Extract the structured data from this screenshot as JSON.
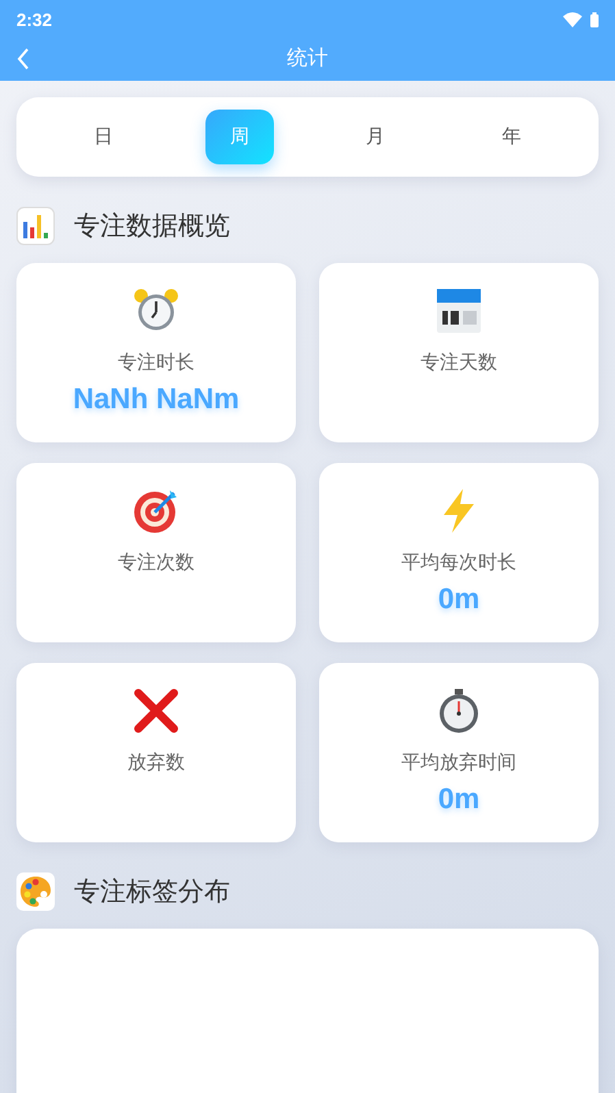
{
  "status_bar": {
    "time": "2:32"
  },
  "header": {
    "title": "统计"
  },
  "period_tabs": [
    {
      "label": "日",
      "selected": false
    },
    {
      "label": "周",
      "selected": true
    },
    {
      "label": "月",
      "selected": false
    },
    {
      "label": "年",
      "selected": false
    }
  ],
  "overview": {
    "title": "专注数据概览",
    "cards": [
      {
        "label": "专注时长",
        "value": "NaNh NaNm"
      },
      {
        "label": "专注天数"
      },
      {
        "label": "专注次数"
      },
      {
        "label": "平均每次时长",
        "value": "0m"
      },
      {
        "label": "放弃数"
      },
      {
        "label": "平均放弃时间",
        "value": "0m"
      }
    ]
  },
  "tag_distribution": {
    "title": "专注标签分布"
  }
}
